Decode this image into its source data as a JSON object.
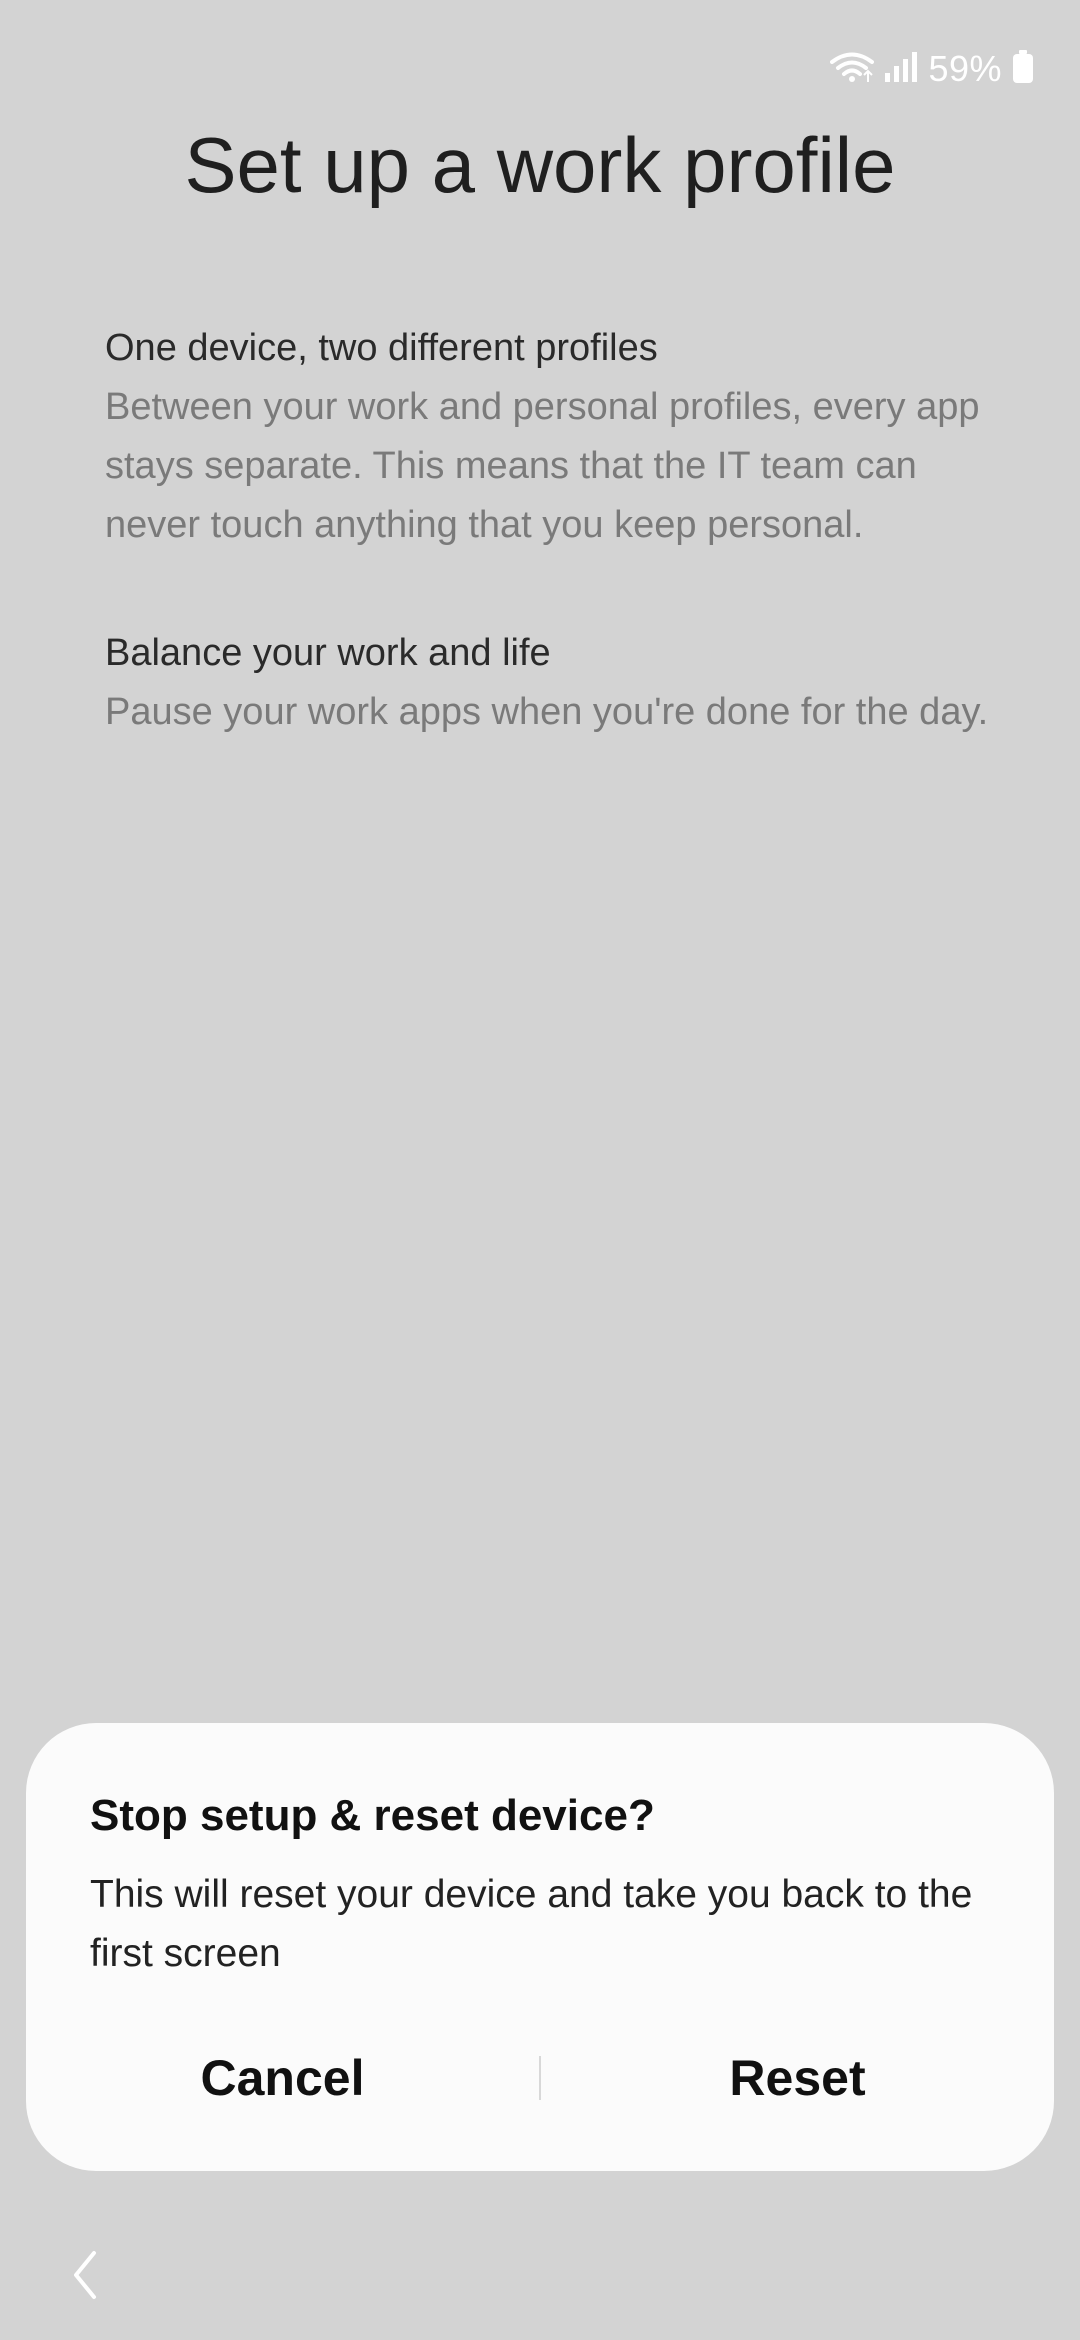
{
  "status_bar": {
    "battery_percent": "59%",
    "icons": [
      "wifi-icon",
      "signal-icon",
      "battery-icon"
    ]
  },
  "page": {
    "title": "Set up a work profile",
    "sections": [
      {
        "heading": "One device, two different profiles",
        "body": "Between your work and personal profiles, every app stays separate. This means that the IT team can never touch anything that you keep personal."
      },
      {
        "heading": "Balance your work and life",
        "body": "Pause your work apps when you're done for the day."
      }
    ]
  },
  "dialog": {
    "title": "Stop setup & reset device?",
    "message": "This will reset your device and take you back to the first screen",
    "cancel_label": "Cancel",
    "reset_label": "Reset"
  },
  "nav": {
    "back_icon": "chevron-left-icon"
  },
  "colors": {
    "background": "#d3d3d3",
    "dialog_background": "#fbfbfb",
    "heading_text": "#2a2a2a",
    "body_text": "#7a7a7a"
  }
}
